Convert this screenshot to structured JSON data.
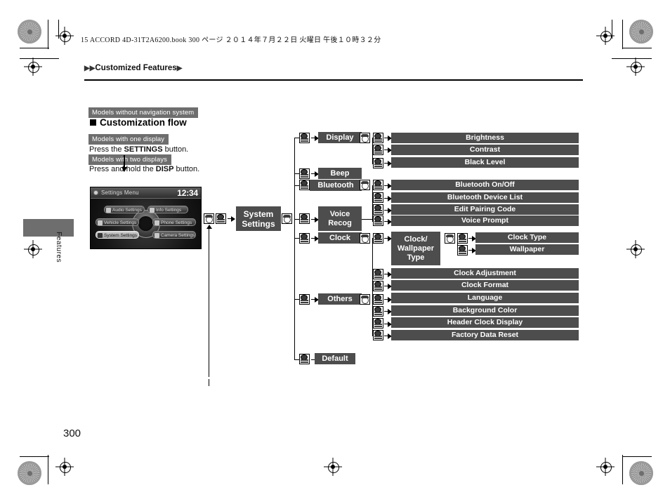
{
  "header": {
    "book_line": "15 ACCORD 4D-31T2A6200.book   300 ページ   ２０１４年７月２２日   火曜日   午後１０時３２分",
    "breadcrumb": "Customized Features",
    "breadcrumb_prefix": "▶▶",
    "breadcrumb_suffix": "▶"
  },
  "side": {
    "tab_label": "Features",
    "page_number": "300"
  },
  "left": {
    "tag_no_nav": "Models without navigation system",
    "section_title": "Customization flow",
    "tag_one_display": "Models with one display",
    "instruction_one": {
      "pre": "Press the ",
      "bold": "SETTINGS",
      "post": " button."
    },
    "tag_two_displays": "Models with two displays",
    "instruction_two": {
      "pre": "Press and hold the ",
      "bold": "DISP",
      "post": " button."
    }
  },
  "device": {
    "title": "Settings Menu",
    "clock": "12:34",
    "menu_items": [
      {
        "label": "Audio Settings",
        "selected": false
      },
      {
        "label": "Info Settings",
        "selected": false
      },
      {
        "label": "Vehicle Settings",
        "selected": false
      },
      {
        "label": "Phone Settings",
        "selected": false
      },
      {
        "label": "System Settings",
        "selected": true
      },
      {
        "label": "Camera Settings",
        "selected": false
      }
    ]
  },
  "flow": {
    "root": "System Settings",
    "level1": [
      "Display",
      "Beep",
      "Bluetooth",
      "Voice Recog",
      "Clock",
      "Others",
      "Default"
    ],
    "display_label": "Display",
    "beep_label": "Beep",
    "bluetooth_label": "Bluetooth",
    "voice_recog_label": "Voice\nRecog",
    "voice_recog_line1": "Voice",
    "voice_recog_line2": "Recog",
    "clock_label": "Clock",
    "others_label": "Others",
    "default_label": "Default",
    "clock_wallpaper_l1": "Clock/",
    "clock_wallpaper_l2": "Wallpaper",
    "clock_wallpaper_l3": "Type",
    "leaves": {
      "brightness": "Brightness",
      "contrast": "Contrast",
      "black_level": "Black Level",
      "bluetooth_onoff": "Bluetooth On/Off",
      "bluetooth_device_list": "Bluetooth Device List",
      "edit_pairing_code": "Edit Pairing Code",
      "voice_prompt": "Voice Prompt",
      "clock_type": "Clock Type",
      "wallpaper": "Wallpaper",
      "clock_adjustment": "Clock Adjustment",
      "clock_format": "Clock Format",
      "language": "Language",
      "background_color": "Background Color",
      "header_clock_display": "Header Clock Display",
      "factory_data_reset": "Factory Data Reset"
    },
    "icons": {
      "dial": "rotate-dial-icon",
      "press": "press-enter-icon"
    }
  },
  "colors": {
    "box_gray": "#4d4d4d",
    "tag_gray": "#6e6e6e",
    "text_black": "#000000"
  }
}
